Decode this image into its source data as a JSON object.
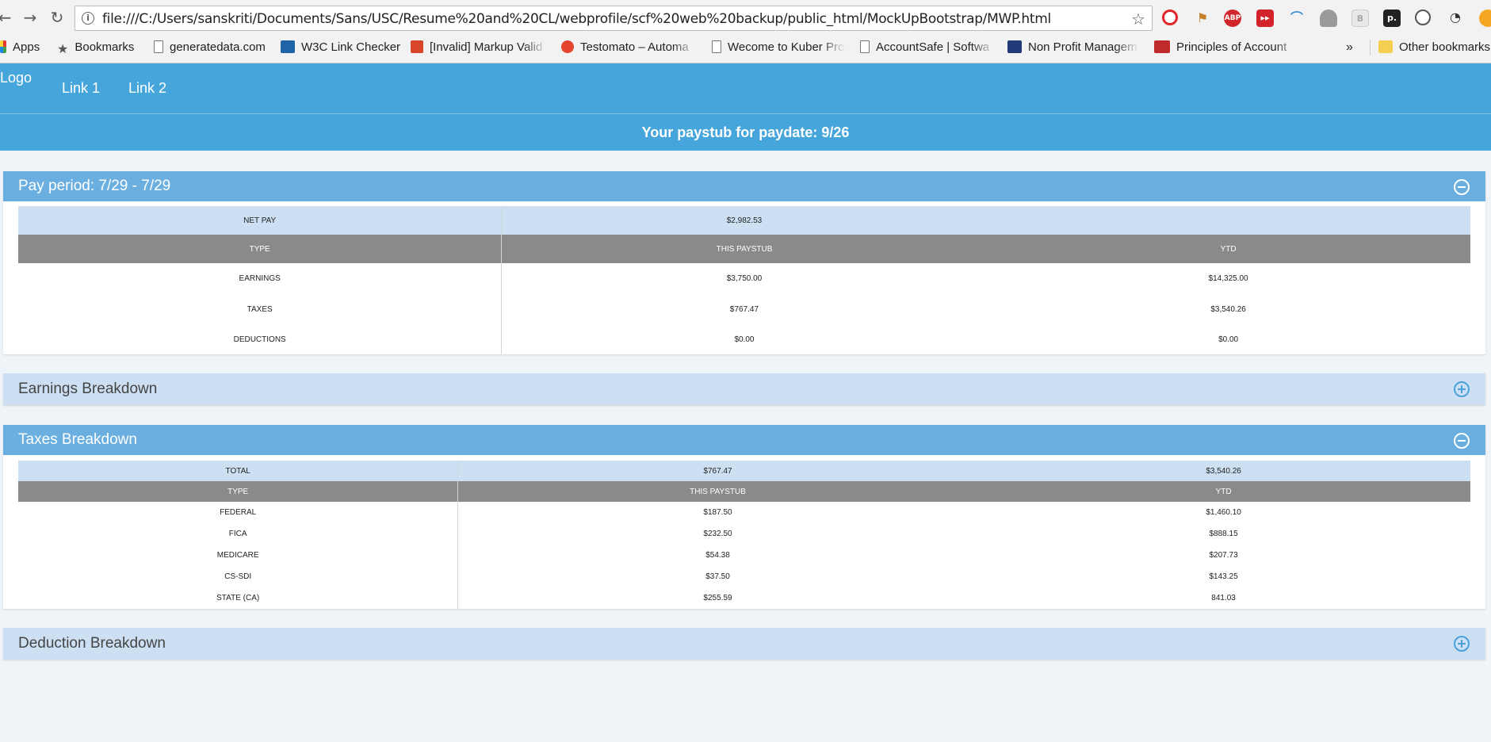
{
  "browser": {
    "url": "file:///C:/Users/sanskriti/Documents/Sans/USC/Resume%20and%20CL/webprofile/scf%20web%20backup/public_html/MockUpBootstrap/MWP.html",
    "bookmarks": [
      "Apps",
      "Bookmarks",
      "generatedata.com",
      "W3C Link Checker",
      "[Invalid] Markup Valid",
      "Testomato – Automa",
      "Wecome to Kuber Pro",
      "AccountSafe | Softwa",
      "Non Profit Managem",
      "Principles of Account"
    ],
    "overflow_chevron": "»",
    "other_bookmarks": "Other bookmarks",
    "extensions": [
      "opera-icon",
      "bookmark-flag-icon",
      "adblock-plus-icon",
      "media-skip-icon",
      "rainbow-icon",
      "puzzle-icon",
      "b-icon",
      "p-icon",
      "spiral-icon",
      "gauge-icon",
      "orange-circle-icon"
    ],
    "extension_labels": {
      "abp": "ABP",
      "b": "B",
      "p": "p."
    }
  },
  "site": {
    "logo_alt": "Logo",
    "nav_links": [
      "Link 1",
      "Link 2"
    ],
    "paystub_title": "Your paystub for paydate: 9/26"
  },
  "pay_period": {
    "title": "Pay period: 7/29 - 7/29",
    "net_pay_label": "NET PAY",
    "net_pay_value": "$2,982.53",
    "headers": [
      "TYPE",
      "THIS PAYSTUB",
      "YTD"
    ],
    "rows": [
      [
        "EARNINGS",
        "$3,750.00",
        "$14,325.00"
      ],
      [
        "TAXES",
        "$767.47",
        "$3,540.26"
      ],
      [
        "DEDUCTIONS",
        "$0.00",
        "$0.00"
      ]
    ]
  },
  "earnings_breakdown": {
    "title": "Earnings Breakdown"
  },
  "taxes_breakdown": {
    "title": "Taxes Breakdown",
    "total_label": "TOTAL",
    "total_this": "$767.47",
    "total_ytd": "$3,540.26",
    "headers": [
      "TYPE",
      "THIS PAYSTUB",
      "YTD"
    ],
    "rows": [
      [
        "FEDERAL",
        "$187.50",
        "$1,460.10"
      ],
      [
        "FICA",
        "$232.50",
        "$888.15"
      ],
      [
        "MEDICARE",
        "$54.38",
        "$207.73"
      ],
      [
        "CS-SDI",
        "$37.50",
        "$143.25"
      ],
      [
        "STATE (CA)",
        "$255.59",
        "841.03"
      ]
    ]
  },
  "deduction_breakdown": {
    "title": "Deduction Breakdown"
  },
  "colors": {
    "nav_blue": "#46a6db",
    "panel_head_open": "#6aafe0",
    "panel_head_closed": "#cde0f3",
    "table_header": "#8a8a8a",
    "summary_row": "#cde0f3",
    "page_bg": "#eef4f8"
  }
}
